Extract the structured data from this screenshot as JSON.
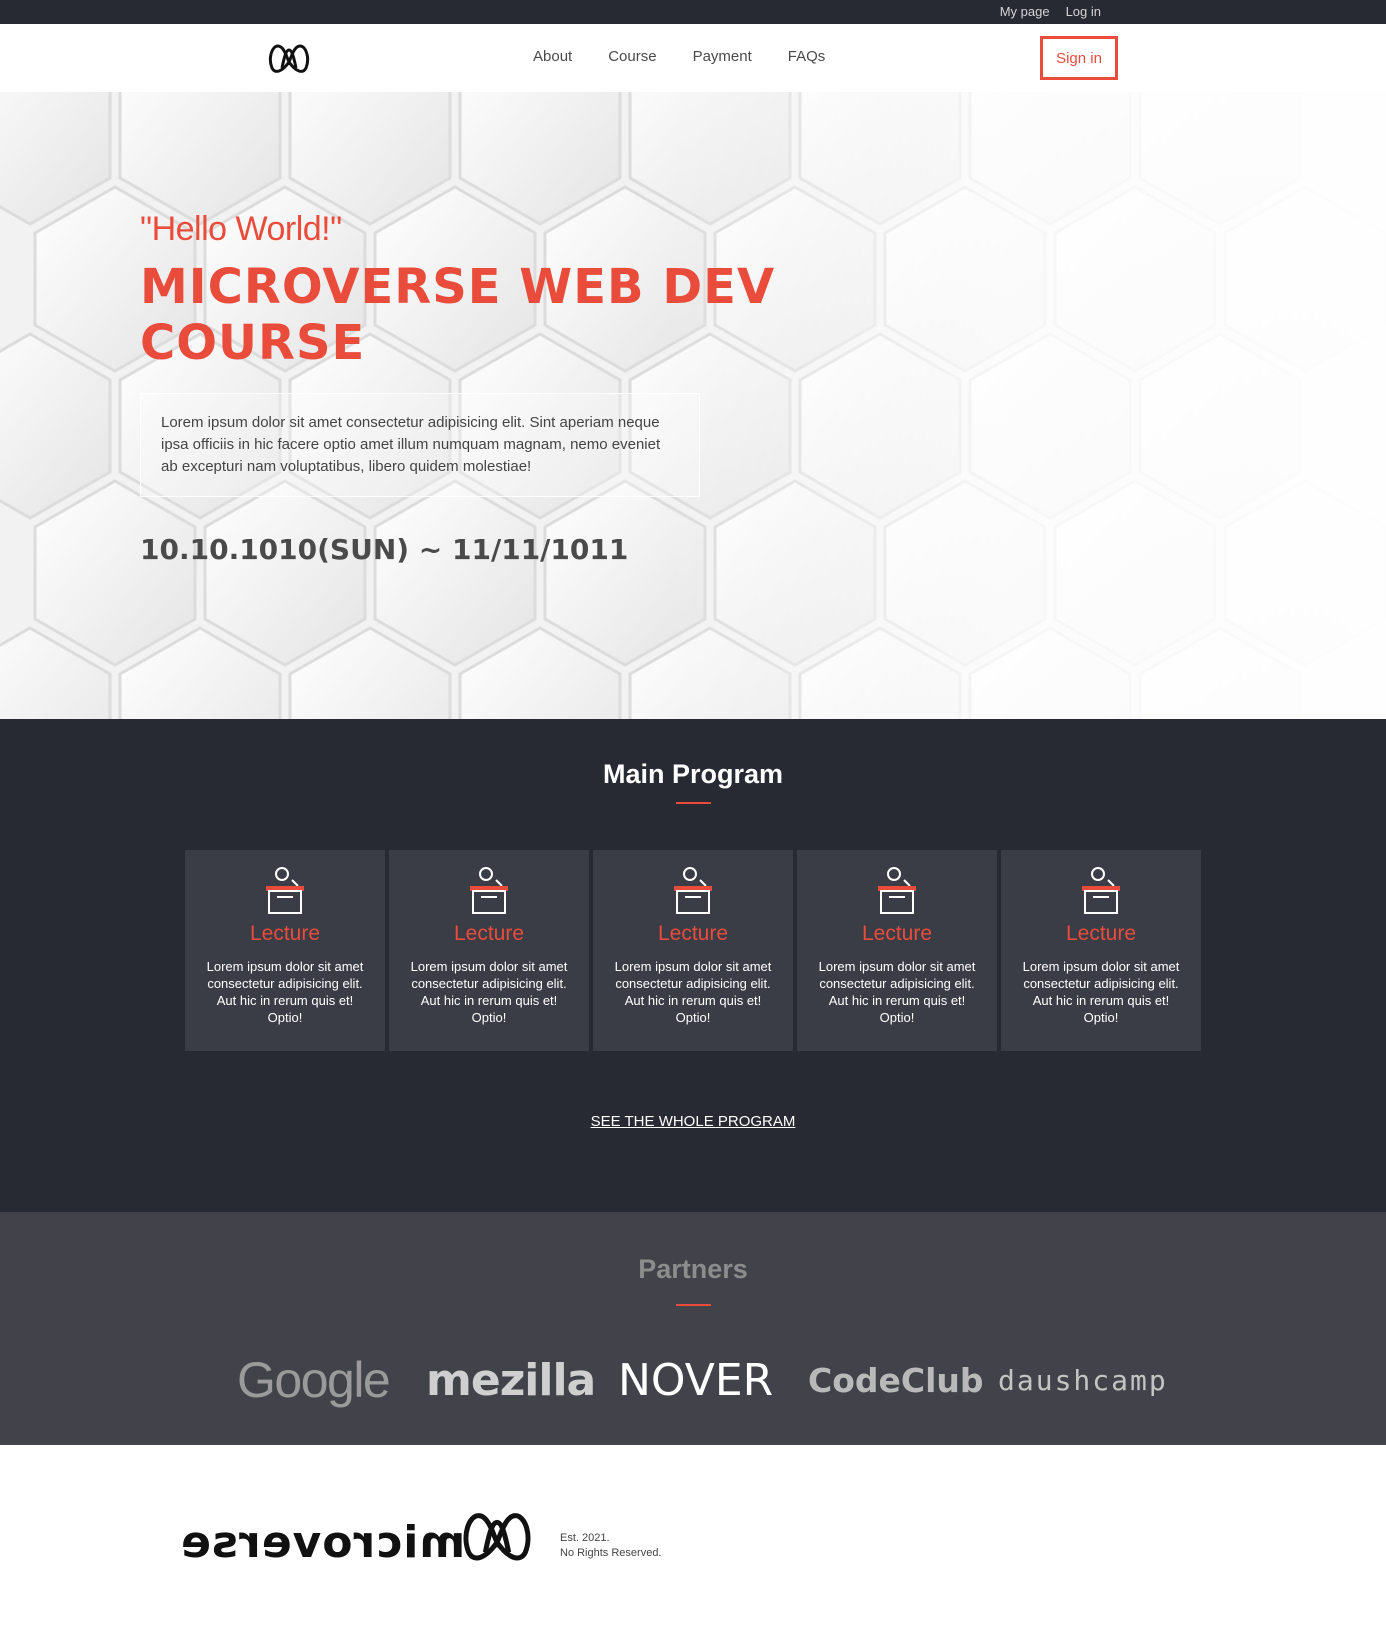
{
  "topbar": {
    "my_page": "My page",
    "log_in": "Log in"
  },
  "header": {
    "nav": [
      "About",
      "Course",
      "Payment",
      "FAQs"
    ],
    "signin": "Sign in"
  },
  "hero": {
    "quote": "\"Hello World!\"",
    "title_line1": "MICROVERSE WEB DEV",
    "title_line2": "COURSE",
    "description": "Lorem ipsum dolor sit amet consectetur adipisicing elit. Sint aperiam neque ipsa officiis in hic facere optio amet illum numquam magnam, nemo eveniet ab excepturi nam voluptatibus, libero quidem molestiae!",
    "date": "10.10.1010(SUN) ~ 11/11/1011"
  },
  "program": {
    "title": "Main Program",
    "cards": [
      {
        "title": "Lecture",
        "text": "Lorem ipsum dolor sit amet consectetur adipisicing elit. Aut hic in rerum quis et! Optio!"
      },
      {
        "title": "Lecture",
        "text": "Lorem ipsum dolor sit amet consectetur adipisicing elit. Aut hic in rerum quis et! Optio!"
      },
      {
        "title": "Lecture",
        "text": "Lorem ipsum dolor sit amet consectetur adipisicing elit. Aut hic in rerum quis et! Optio!"
      },
      {
        "title": "Lecture",
        "text": "Lorem ipsum dolor sit amet consectetur adipisicing elit. Aut hic in rerum quis et! Optio!"
      },
      {
        "title": "Lecture",
        "text": "Lorem ipsum dolor sit amet consectetur adipisicing elit. Aut hic in rerum quis et! Optio!"
      }
    ],
    "card_icon": "lecture-podium-icon",
    "see_all": "SEE THE WHOLE PROGRAM"
  },
  "partners": {
    "title": "Partners",
    "logos": [
      "Google",
      "mezilla",
      "NOVER",
      "CodeClub",
      "daushcamp"
    ]
  },
  "footer": {
    "brand": "microverse",
    "est": "Est. 2021.",
    "rights": "No Rights Reserved."
  },
  "colors": {
    "accent": "#ea4c3c",
    "dark": "#272a33",
    "card": "#3a3d46",
    "partners_bg": "#41424a"
  }
}
